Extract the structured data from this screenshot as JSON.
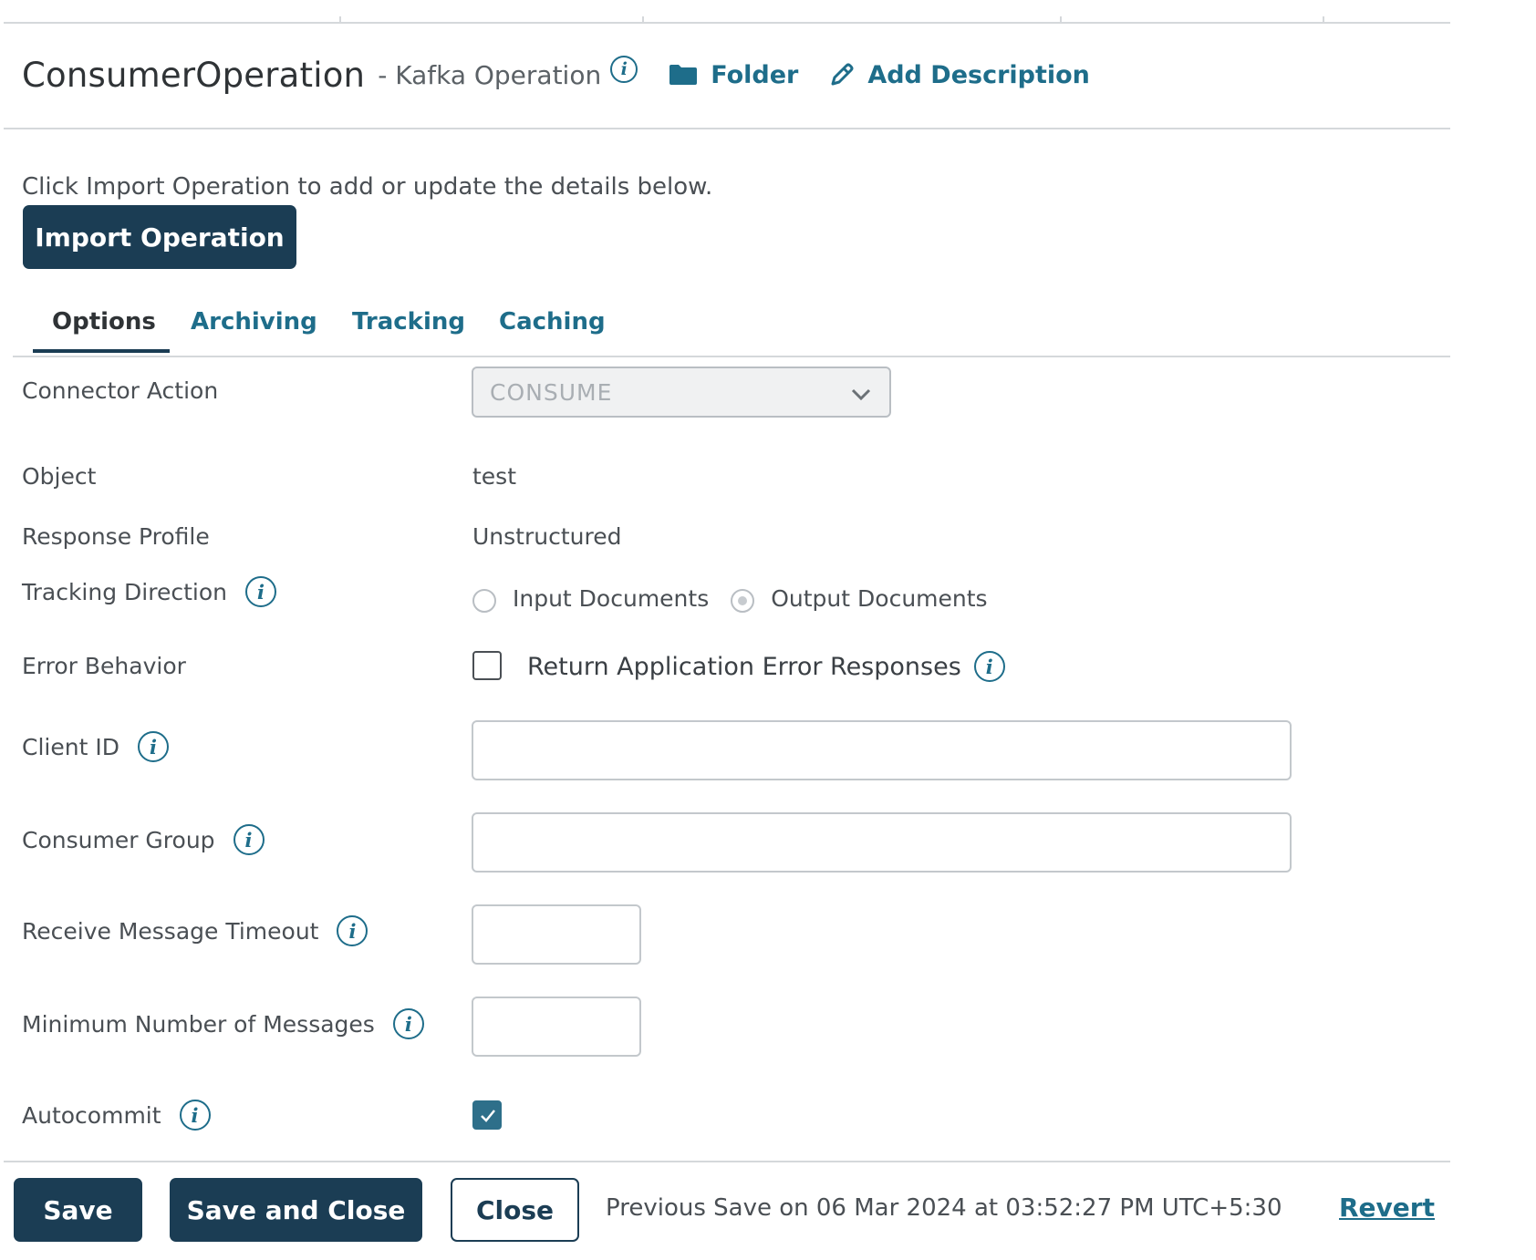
{
  "header": {
    "operation_name": "ConsumerOperation",
    "operation_type": "- Kafka Operation",
    "folder_label": "Folder",
    "add_description_label": "Add Description",
    "icons": [
      "info-icon",
      "folder-icon",
      "pencil-icon"
    ]
  },
  "intro": {
    "hint": "Click Import Operation to add or update the details below.",
    "import_button": "Import Operation"
  },
  "tabs": [
    {
      "label": "Options",
      "active": true
    },
    {
      "label": "Archiving",
      "active": false
    },
    {
      "label": "Tracking",
      "active": false
    },
    {
      "label": "Caching",
      "active": false
    }
  ],
  "form": {
    "connector_action": {
      "label": "Connector Action",
      "value": "CONSUME"
    },
    "object": {
      "label": "Object",
      "value": "test"
    },
    "response_profile": {
      "label": "Response Profile",
      "value": "Unstructured"
    },
    "tracking_direction": {
      "label": "Tracking Direction",
      "options": [
        {
          "label": "Input Documents",
          "selected": false
        },
        {
          "label": "Output Documents",
          "selected": true
        }
      ]
    },
    "error_behavior": {
      "label": "Error Behavior",
      "checkbox_label": "Return Application Error Responses",
      "checked": false
    },
    "client_id": {
      "label": "Client ID",
      "value": ""
    },
    "consumer_group": {
      "label": "Consumer Group",
      "value": ""
    },
    "receive_message_timeout": {
      "label": "Receive Message Timeout",
      "value": ""
    },
    "minimum_number_of_messages": {
      "label": "Minimum Number of Messages",
      "value": ""
    },
    "autocommit": {
      "label": "Autocommit",
      "checked": true
    }
  },
  "footer": {
    "save": "Save",
    "save_and_close": "Save and Close",
    "close": "Close",
    "previous_save": "Previous Save on 06 Mar 2024 at 03:52:27 PM UTC+5:30",
    "revert": "Revert"
  },
  "colors": {
    "primary_dark": "#1b3d54",
    "link": "#1e6d8a",
    "text": "#4a4f54",
    "border": "#d5d8db"
  }
}
